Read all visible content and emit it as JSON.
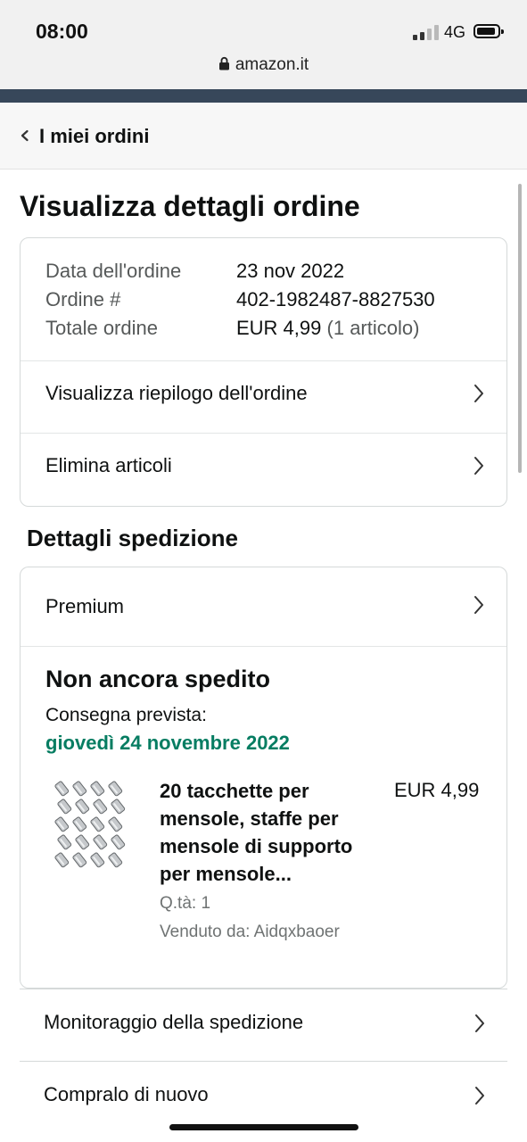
{
  "status_bar": {
    "time": "08:00",
    "network": "4G",
    "url": "amazon.it"
  },
  "back": {
    "label": "I miei ordini",
    "icon": "chevron-left-icon"
  },
  "page": {
    "title": "Visualizza dettagli ordine"
  },
  "order": {
    "date_label": "Data dell'ordine",
    "date_value": "23 nov 2022",
    "number_label": "Ordine #",
    "number_value": "402-1982487-8827530",
    "total_label": "Totale ordine",
    "total_value": "EUR 4,99",
    "total_items": "(1 articolo)",
    "links": [
      {
        "label": "Visualizza riepilogo dell'ordine"
      },
      {
        "label": "Elimina articoli"
      }
    ]
  },
  "shipping": {
    "section_title": "Dettagli spedizione",
    "method": "Premium",
    "status": "Non ancora spedito",
    "eta_label": "Consegna prevista:",
    "eta_date": "giovedì 24 novembre 2022",
    "eta_color": "#067d62",
    "product": {
      "title": "20 tacchette per mensole, staffe per mensole di supporto per mensole...",
      "price": "EUR 4,99",
      "qty": "Q.tà: 1",
      "seller": "Venduto da: Aidqxbaoer"
    }
  },
  "actions": [
    {
      "label": "Monitoraggio della spedizione"
    },
    {
      "label": "Compralo di nuovo"
    }
  ],
  "colors": {
    "nav_strip": "#37475a",
    "accent_green": "#067d62",
    "border": "#d5d9d9"
  }
}
